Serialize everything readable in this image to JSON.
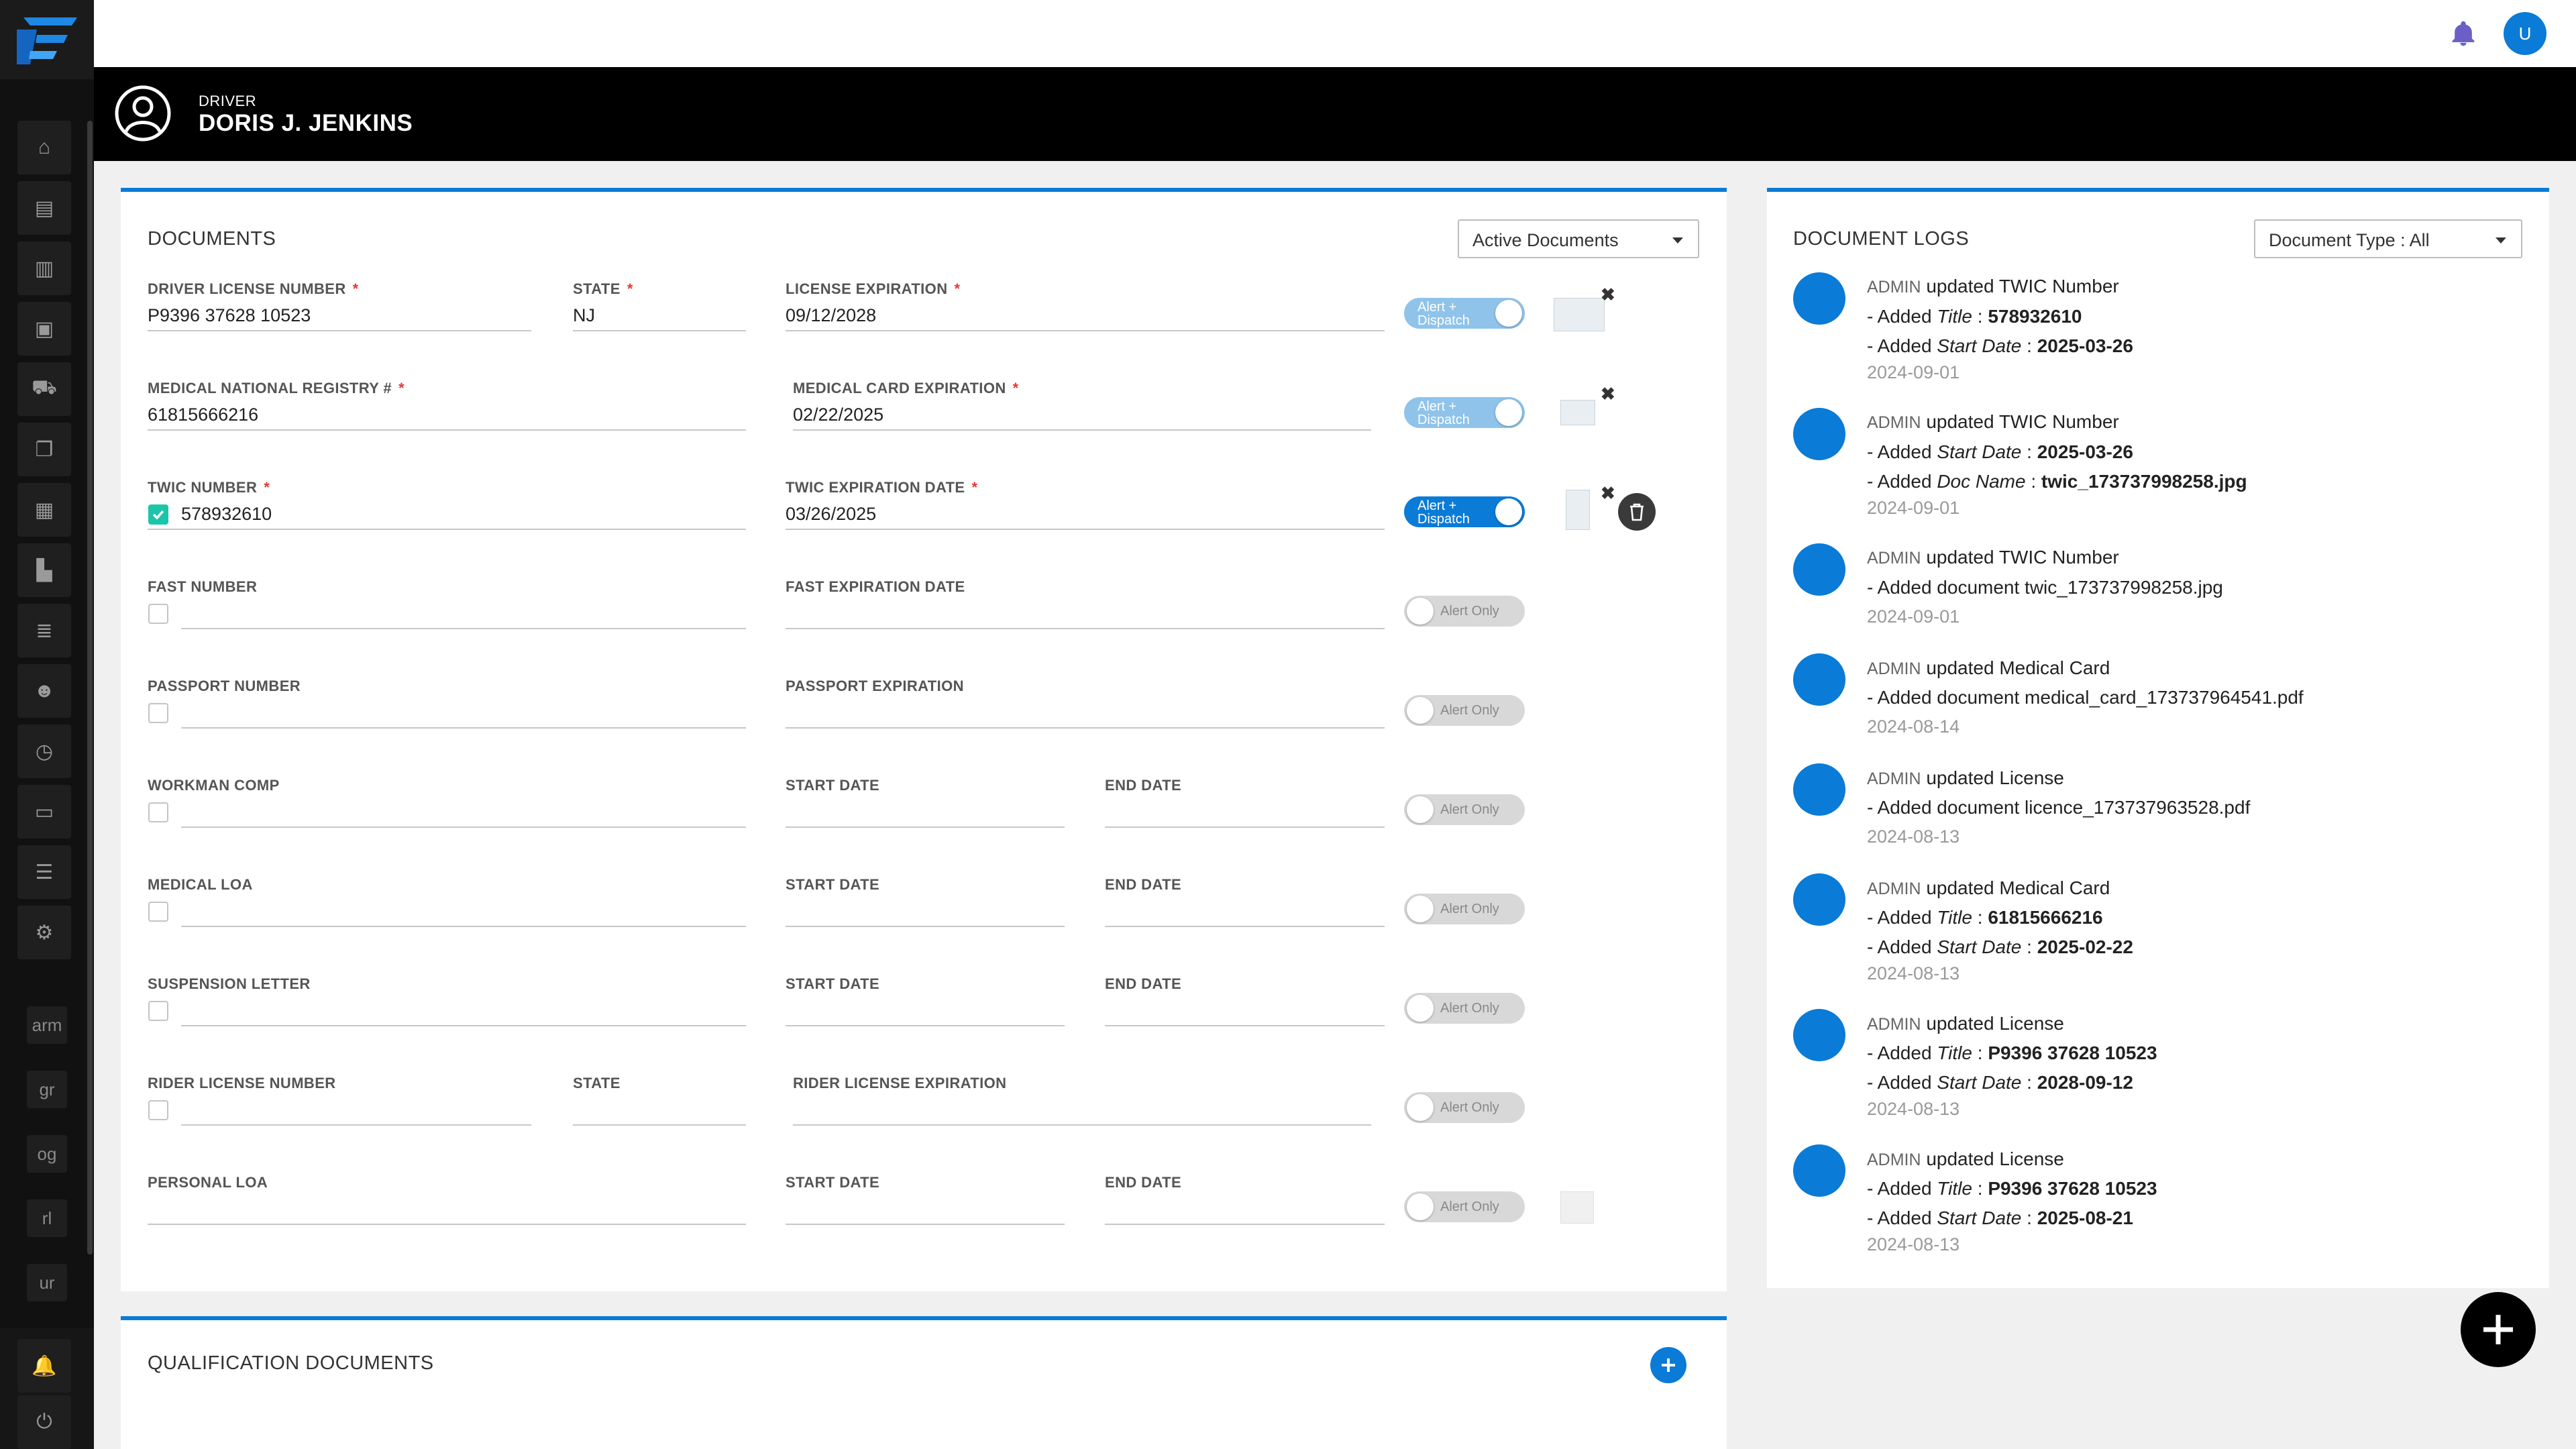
{
  "header": {
    "role": "DRIVER",
    "name": "DORIS J. JENKINS"
  },
  "topbar": {
    "avatar_initial": "U"
  },
  "sidebar": {
    "text_items": [
      "arm",
      "gr",
      "og",
      "rl",
      "ur"
    ]
  },
  "documents": {
    "title": "DOCUMENTS",
    "filter_value": "Active Documents",
    "driver_license": {
      "label": "DRIVER LICENSE NUMBER",
      "value": "P9396 37628 10523"
    },
    "state": {
      "label": "STATE",
      "value": "NJ"
    },
    "license_expiration": {
      "label": "LICENSE EXPIRATION",
      "value": "09/12/2028"
    },
    "medical_registry": {
      "label": "MEDICAL NATIONAL REGISTRY #",
      "value": "61815666216"
    },
    "medical_card_expiration": {
      "label": "MEDICAL CARD EXPIRATION",
      "value": "02/22/2025"
    },
    "twic_number": {
      "label": "TWIC NUMBER",
      "value": "578932610"
    },
    "twic_expiration": {
      "label": "TWIC EXPIRATION DATE",
      "value": "03/26/2025"
    },
    "fast_number": {
      "label": "FAST NUMBER"
    },
    "fast_expiration": {
      "label": "FAST EXPIRATION DATE"
    },
    "passport_number": {
      "label": "PASSPORT NUMBER"
    },
    "passport_expiration": {
      "label": "PASSPORT EXPIRATION"
    },
    "workman_comp": {
      "label": "WORKMAN COMP"
    },
    "medical_loa": {
      "label": "MEDICAL LOA"
    },
    "suspension_letter": {
      "label": "SUSPENSION LETTER"
    },
    "rider_license": {
      "label": "RIDER LICENSE NUMBER"
    },
    "rider_state": {
      "label": "STATE"
    },
    "rider_license_expiration": {
      "label": "RIDER LICENSE EXPIRATION"
    },
    "personal_loa": {
      "label": "PERSONAL LOA"
    },
    "start_date_label": "START DATE",
    "end_date_label": "END DATE",
    "toggle_on_label": "Alert + Dispatch",
    "toggle_off_label": "Alert Only",
    "required_mark": "*"
  },
  "logs": {
    "title": "DOCUMENT LOGS",
    "filter_value": "Document Type : All",
    "admin": "ADMIN",
    "entries": [
      {
        "action": "updated TWIC Number",
        "l1_pre": "- Added ",
        "l1_key": "Title",
        "l1_val": "578932610",
        "l2_pre": "- Added ",
        "l2_key": "Start Date",
        "l2_val": "2025-03-26",
        "date": "2024-09-01"
      },
      {
        "action": "updated TWIC Number",
        "l1_pre": "- Added ",
        "l1_key": "Start Date",
        "l1_val": "2025-03-26",
        "l2_pre": "- Added ",
        "l2_key": "Doc Name",
        "l2_val": "twic_173737998258.jpg",
        "date": "2024-09-01"
      },
      {
        "action": "updated TWIC Number",
        "line": "- Added document twic_173737998258.jpg",
        "date": "2024-09-01"
      },
      {
        "action": "updated Medical Card",
        "line": "- Added document medical_card_173737964541.pdf",
        "date": "2024-08-14"
      },
      {
        "action": "updated License",
        "line": "- Added document licence_173737963528.pdf",
        "date": "2024-08-13"
      },
      {
        "action": "updated Medical Card",
        "l1_pre": "- Added ",
        "l1_key": "Title",
        "l1_val": "61815666216",
        "l2_pre": "- Added ",
        "l2_key": "Start Date",
        "l2_val": "2025-02-22",
        "date": "2024-08-13"
      },
      {
        "action": "updated License",
        "l1_pre": "- Added ",
        "l1_key": "Title",
        "l1_val": "P9396 37628 10523",
        "l2_pre": "- Added ",
        "l2_key": "Start Date",
        "l2_val": "2028-09-12",
        "date": "2024-08-13"
      },
      {
        "action": "updated License",
        "l1_pre": "- Added ",
        "l1_key": "Title",
        "l1_val": "P9396 37628 10523",
        "l2_pre": "- Added ",
        "l2_key": "Start Date",
        "l2_val": "2025-08-21",
        "date": "2024-08-13"
      }
    ]
  },
  "qualification": {
    "title": "QUALIFICATION DOCUMENTS"
  },
  "colors": {
    "accent": "#0a7bd6",
    "check": "#1cc5a9",
    "required": "#e53935"
  }
}
